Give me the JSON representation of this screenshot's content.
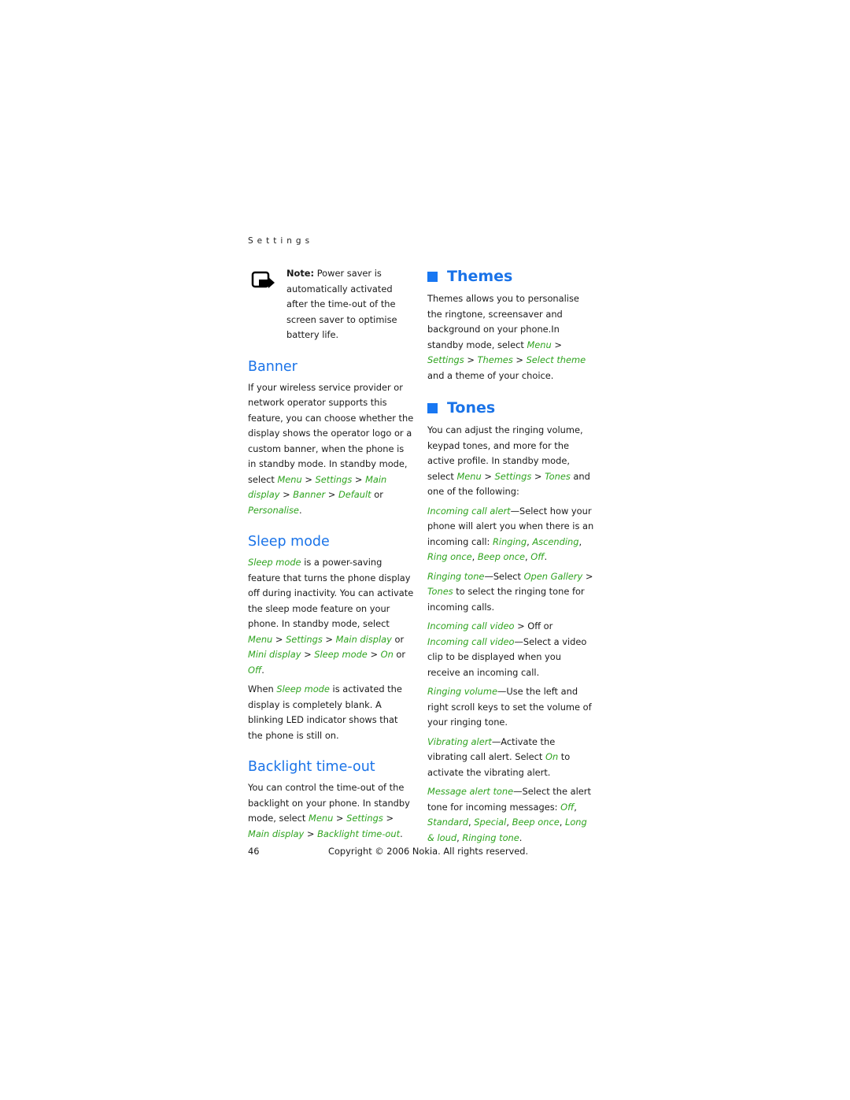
{
  "running_head": "Settings",
  "accent_colors": {
    "heading_blue": "#1a73e8",
    "link_green": "#2ea31f"
  },
  "note": {
    "icon": "note-icon",
    "label": "Note:",
    "text": " Power saver is automatically activated after the time-out of the screen saver to optimise battery life."
  },
  "banner": {
    "title": "Banner",
    "p1": "If your wireless service provider or network operator supports this feature, you can choose whether the display shows the operator logo or a custom banner, when the phone is in standby mode. In standby mode, select ",
    "menu": "Menu",
    "settings": "Settings",
    "main_display": "Main display",
    "banner": "Banner",
    "default": "Default",
    "or": " or ",
    "personalise": "Personalise",
    "sep": " > ",
    "end": "."
  },
  "sleep_mode": {
    "title": "Sleep mode",
    "term": "Sleep mode",
    "p1": " is a power-saving feature that turns the phone display off during inactivity. You can activate the sleep mode feature on your phone. In standby mode, select ",
    "menu": "Menu",
    "settings": "Settings",
    "main_display": "Main display",
    "or": " or ",
    "mini_display": "Mini display",
    "sleep_mode": "Sleep mode",
    "on": "On",
    "off": "Off",
    "sep": " > ",
    "end": ".",
    "p2_start": "When ",
    "p2_term": "Sleep mode",
    "p2_rest": " is activated the display is completely blank. A blinking LED indicator shows that the phone is still on."
  },
  "backlight": {
    "title": "Backlight time-out",
    "p1": "You can control the time-out of the backlight on your phone. In standby mode, select ",
    "menu": "Menu",
    "settings": "Settings",
    "main_display": "Main display",
    "backlight": "Backlight time-out",
    "sep": " > ",
    "end": "."
  },
  "themes": {
    "title": "Themes",
    "p1": "Themes allows you to personalise the ringtone, screensaver and background on your phone.In standby mode, select ",
    "menu": "Menu",
    "settings": "Settings",
    "themes": "Themes",
    "select_theme": "Select theme",
    "sep": " > ",
    "end": " and a theme of your choice."
  },
  "tones": {
    "title": "Tones",
    "p1": "You can adjust the ringing volume, keypad tones, and more for the active profile. In standby mode, select ",
    "menu": "Menu",
    "settings": "Settings",
    "tones": "Tones",
    "sep": " > ",
    "end": " and one of the following:",
    "items": [
      {
        "term": "Incoming call alert",
        "text": "—Select how your phone will alert you when there is an incoming call: ",
        "opts": [
          "Ringing",
          "Ascending",
          "Ring once",
          "Beep once",
          "Off"
        ]
      },
      {
        "term": "Ringing tone",
        "text": "—Select ",
        "opt1": "Open Gallery",
        "opt2": "Tones",
        "rest": " to select the ringing tone for incoming calls."
      },
      {
        "term": "Incoming call video",
        "mid": " > Off or ",
        "term2": "Incoming call video",
        "rest": "—Select a video clip to be displayed when you receive an incoming call."
      },
      {
        "term": "Ringing volume",
        "rest": "—Use the left and right scroll keys to set the volume of your ringing tone."
      },
      {
        "term": "Vibrating alert",
        "rest": "—Activate the vibrating call alert. Select ",
        "on": "On",
        "rest2": " to activate the vibrating alert."
      },
      {
        "term": "Message alert tone",
        "text": "—Select the alert tone for incoming messages: ",
        "opts": [
          "Off",
          "Standard",
          "Special",
          "Beep once",
          "Long & loud",
          "Ringing tone"
        ]
      }
    ]
  },
  "footer": {
    "page_number": "46",
    "copyright": "Copyright © 2006 Nokia. All rights reserved."
  }
}
